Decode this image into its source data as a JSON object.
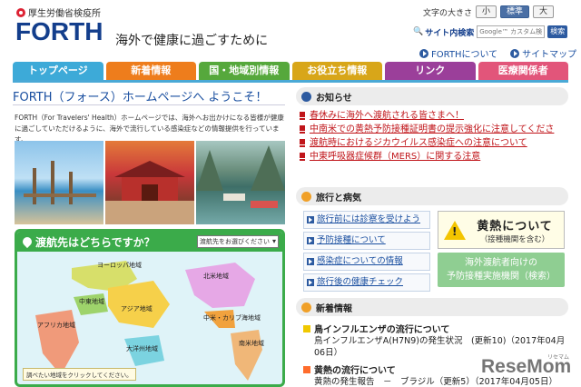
{
  "header": {
    "ministry": "厚生労働省検疫所",
    "logo": "FORTH",
    "tagline": "海外で健康に過ごすために",
    "fontsize_label": "文字の大きさ",
    "fontsize_options": [
      "小",
      "標準",
      "大"
    ],
    "fontsize_selected": "標準",
    "search_label": "サイト内検索",
    "search_placeholder": "Google™ カスタム検索",
    "search_button": "検索",
    "links": [
      "FORTHについて",
      "サイトマップ"
    ]
  },
  "nav": {
    "tabs": [
      {
        "label": "トップページ",
        "color": "#3daad8"
      },
      {
        "label": "新着情報",
        "color": "#ee7d1c"
      },
      {
        "label": "国・地域別情報",
        "color": "#56a83c"
      },
      {
        "label": "お役立ち情報",
        "color": "#d8a619"
      },
      {
        "label": "リンク",
        "color": "#9b3f9a"
      },
      {
        "label": "医療関係者",
        "color": "#e2557a"
      }
    ]
  },
  "welcome": {
    "title": "FORTH（フォース）ホームページへ ようこそ！",
    "intro": "FORTH（For Travelers' Health）ホームページでは、海外へお出かけになる皆様が健康に過ごしていただけるように、海外で流行している感染症などの情報提供を行っています。"
  },
  "map": {
    "question": "渡航先はどちらですか？",
    "select_value": "渡航先をお選びください",
    "regions": [
      "ヨーロッパ地域",
      "北米地域",
      "中東地域",
      "アジア地域",
      "アフリカ地域",
      "大洋州地域",
      "中米・カリブ海地域",
      "南米地域"
    ],
    "note": "調べたい地域をクリックしてください。"
  },
  "notices": {
    "title": "お知らせ",
    "items": [
      "春休みに海外へ渡航される皆さまへ！",
      "中南米での黄熱予防接種証明書の提示強化に注意してくださ",
      "渡航時におけるジカウイルス感染症への注意について",
      "中東呼吸器症候群（MERS）に関する注意"
    ]
  },
  "travel": {
    "title": "旅行と病気",
    "items": [
      "旅行前には診察を受けよう",
      "予防接種について",
      "感染症についての情報",
      "旅行後の健康チェック"
    ],
    "yellow_main": "黄熱について",
    "yellow_sub": "（接種機関を含む）",
    "green_line1": "海外渡航者向けの",
    "green_line2": "予防接種実施機関（検索）"
  },
  "news": {
    "title": "新着情報",
    "items": [
      {
        "title": "鳥インフルエンザの流行について",
        "sub": "鳥インフルエンザA(H7N9)の発生状況　(更新10)（2017年04月06日）"
      },
      {
        "title": "黄熱の流行について",
        "sub": "黄熱の発生報告　－　ブラジル（更新5）（2017年04月05日）"
      }
    ]
  },
  "watermark": {
    "main": "ReseMom",
    "sub": "リセマム"
  }
}
